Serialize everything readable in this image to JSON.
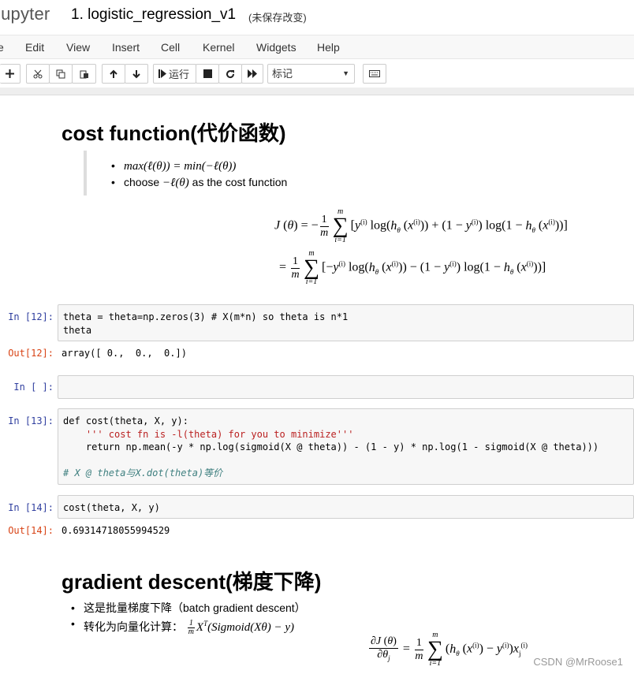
{
  "header": {
    "logo": "jupyter",
    "notebook_title": "1. logistic_regression_v1",
    "save_status": "(未保存改变)"
  },
  "menubar": {
    "items": [
      "e",
      "Edit",
      "View",
      "Insert",
      "Cell",
      "Kernel",
      "Widgets",
      "Help"
    ]
  },
  "toolbar": {
    "run_label": "运行",
    "cell_type": "标记"
  },
  "cells": {
    "h_cost": "cost function(代价函数)",
    "cost_bullets": [
      "max(ℓ(θ)) = min(−ℓ(θ))",
      "choose",
      "−ℓ(θ)",
      "as the cost function"
    ],
    "c12_prompt": "In [12]:",
    "c12_line1": "theta = theta=np.zeros(3) # X(m*n) so theta is n*1",
    "c12_line2": "theta",
    "o12_prompt": "Out[12]:",
    "o12_text": "array([ 0.,  0.,  0.])",
    "empty_prompt": "In [ ]:",
    "c13_prompt": "In [13]:",
    "c13_line1": "def cost(theta, X, y):",
    "c13_line2": "    ''' cost fn is -l(theta) for you to minimize'''",
    "c13_line3": "    return np.mean(-y * np.log(sigmoid(X @ theta)) - (1 - y) * np.log(1 - sigmoid(X @ theta)))",
    "c13_line4": "# X @ theta与X.dot(theta)等价",
    "c14_prompt": "In [14]:",
    "c14_line1": "cost(theta, X, y)",
    "o14_prompt": "Out[14]:",
    "o14_text": "0.69314718055994529",
    "h_grad": "gradient descent(梯度下降)",
    "grad_bullet1": "这是批量梯度下降（batch gradient descent）",
    "grad_bullet2": "转化为向量化计算："
  },
  "watermark": "CSDN @MrRoose1"
}
